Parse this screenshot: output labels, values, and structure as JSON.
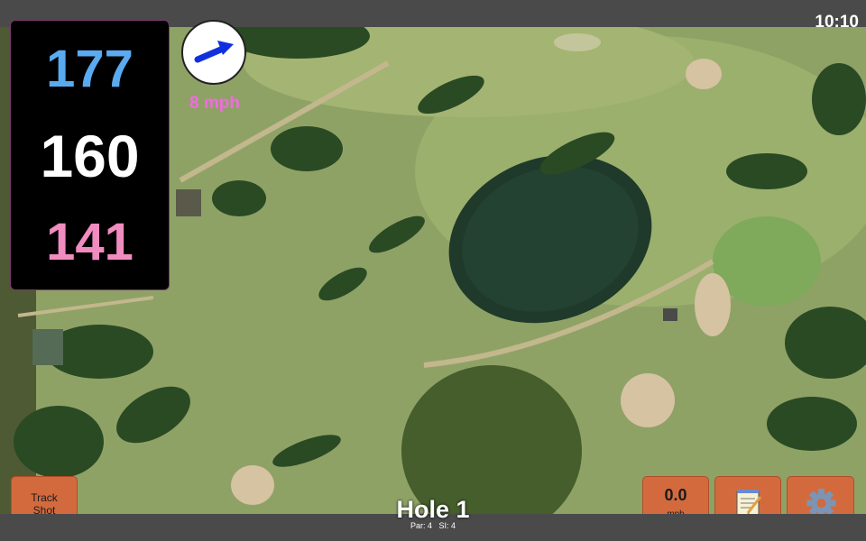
{
  "status": {
    "time": "10:10"
  },
  "yardages": {
    "back": "177",
    "middle": "160",
    "front": "141"
  },
  "wind": {
    "speed_label": "8 mph",
    "direction": "arrow-east-north-east"
  },
  "buttons": {
    "track_line1": "Track",
    "track_line2": "Shot",
    "speed_value": "0.0",
    "speed_unit": "mph",
    "notes_icon": "notepad-icon",
    "settings_icon": "gear-icon"
  },
  "hole": {
    "title": "Hole 1",
    "par_label": "Par: 4",
    "si_label": "SI: 4"
  },
  "colors": {
    "back": "#5aaaf0",
    "middle": "#ffffff",
    "front": "#f08cc0",
    "wind": "#f06ce0",
    "button": "#d36a3e"
  }
}
